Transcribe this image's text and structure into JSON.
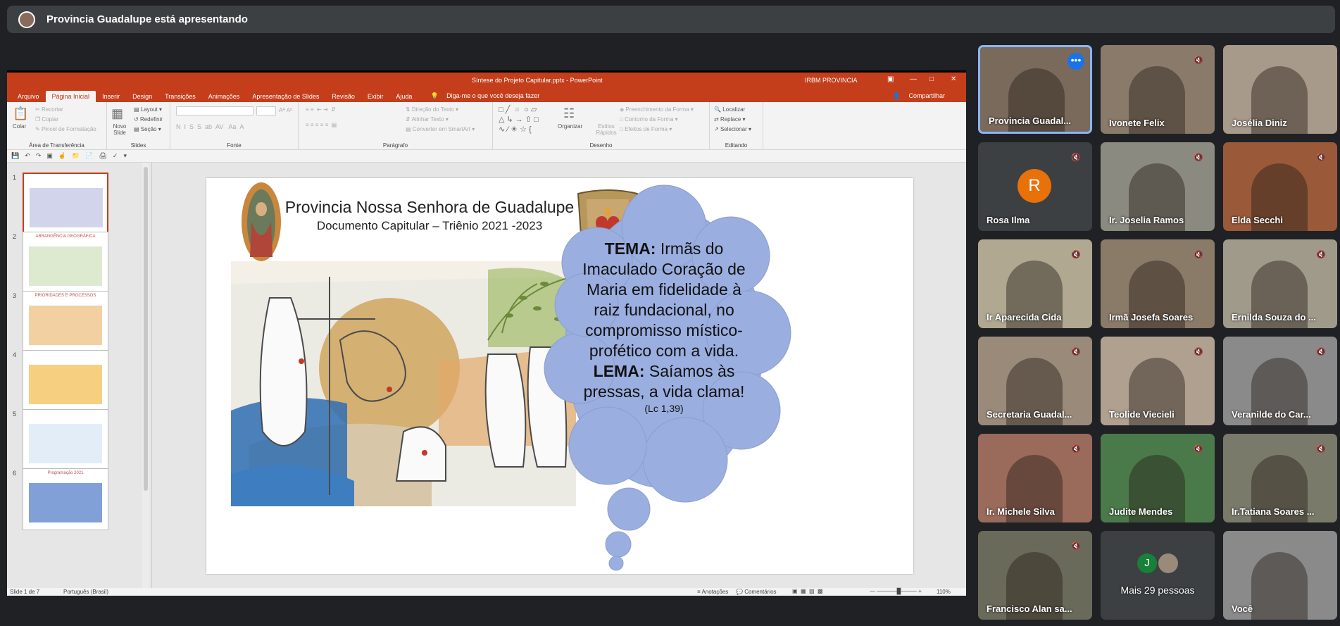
{
  "meet": {
    "presenting_label": "Provincia Guadalupe está apresentando"
  },
  "ppt": {
    "window_title": "Síntese do Projeto Capitular.pptx  -  PowerPoint",
    "user": "IRBM PROVINCIA",
    "tabs": [
      "Arquivo",
      "Página Inicial",
      "Inserir",
      "Design",
      "Transições",
      "Animações",
      "Apresentação de Slides",
      "Revisão",
      "Exibir",
      "Ajuda"
    ],
    "tell_me": "Diga-me o que você deseja fazer",
    "share": "Compartilhar",
    "groups": {
      "clipboard": "Área de Transferência",
      "slides": "Slides",
      "font": "Fonte",
      "paragraph": "Parágrafo",
      "drawing": "Desenho",
      "editing": "Editando"
    },
    "clipboard": {
      "paste": "Colar",
      "cut": "Recortar",
      "copy": "Copiar",
      "format_painter": "Pincel de Formatação"
    },
    "slides": {
      "new": "Novo Slide",
      "layout": "Layout",
      "reset": "Redefinir",
      "section": "Seção"
    },
    "paragraph": {
      "text_direction": "Direção do Texto",
      "align_text": "Alinhar Texto",
      "smartart": "Converter em SmartArt"
    },
    "drawing": {
      "arrange": "Organizar",
      "quick_styles": "Estilos Rápidos",
      "fill": "Preenchimento da Forma",
      "outline": "Contorno da Forma",
      "effects": "Efeitos de Forma"
    },
    "editing": {
      "find": "Localizar",
      "replace": "Replace",
      "select": "Selecionar"
    },
    "status": {
      "slide": "Slide 1 de 7",
      "language": "Português (Brasil)",
      "notes": "Anotações",
      "comments": "Comentários",
      "zoom": "110%"
    }
  },
  "thumbs": [
    {
      "n": "1",
      "text": ""
    },
    {
      "n": "2",
      "text": "ABRANGÊNCIA GEOGRÁFICA"
    },
    {
      "n": "3",
      "text": "PRIORIDADES E PROCESSOS"
    },
    {
      "n": "4",
      "text": ""
    },
    {
      "n": "5",
      "text": ""
    },
    {
      "n": "6",
      "text": "Programação 2021"
    }
  ],
  "slide": {
    "title": "Provincia Nossa Senhora de Guadalupe",
    "subtitle": "Documento Capitular – Triênio 2021 -2023",
    "tema_label": "TEMA:",
    "tema_text": "Irmãs do Imaculado Coração de Maria em fidelidade à raiz fundacional, no compromisso místico-profético com a vida.",
    "lema_label": "LEMA:",
    "lema_text": "Saíamos às pressas, a vida clama!",
    "ref": "(Lc 1,39)"
  },
  "participants": [
    {
      "name": "Provincia Guadal...",
      "muted": false,
      "bg": "#7a6a5c"
    },
    {
      "name": "Ivonete Felix",
      "muted": true,
      "bg": "#8a7a6a"
    },
    {
      "name": "Josélia Diniz",
      "muted": false,
      "bg": "#a89a8a"
    },
    {
      "name": "Rosa Ilma",
      "muted": true,
      "bg": "#3c4043",
      "initial": "R"
    },
    {
      "name": "Ir. Joselia Ramos",
      "muted": true,
      "bg": "#8a8a80"
    },
    {
      "name": "Elda Secchi",
      "muted": true,
      "bg": "#9a5a3a"
    },
    {
      "name": "Ir Aparecida Cida",
      "muted": true,
      "bg": "#b0a890"
    },
    {
      "name": "Irmã Josefa Soares",
      "muted": true,
      "bg": "#8a7a68"
    },
    {
      "name": "Ernilda Souza do ...",
      "muted": true,
      "bg": "#a09a8a"
    },
    {
      "name": "Secretaria Guadal...",
      "muted": true,
      "bg": "#9a8a7a"
    },
    {
      "name": "Teolide Viecieli",
      "muted": true,
      "bg": "#b0a090"
    },
    {
      "name": "Veranilde do Car...",
      "muted": true,
      "bg": "#8a8a8a"
    },
    {
      "name": "Ir. Michele Silva",
      "muted": true,
      "bg": "#9a6a5a"
    },
    {
      "name": "Judite Mendes",
      "muted": true,
      "bg": "#4a7a4a"
    },
    {
      "name": "Ir.Tatiana Soares ...",
      "muted": true,
      "bg": "#7a7a6a"
    },
    {
      "name": "Francisco Alan sa...",
      "muted": true,
      "bg": "#6a6a5a"
    },
    {
      "name": "Mais 29 pessoas",
      "muted": false,
      "bg": "#3c4043",
      "initial": "J"
    },
    {
      "name": "Você",
      "muted": false,
      "bg": "#8a8a8a"
    }
  ]
}
